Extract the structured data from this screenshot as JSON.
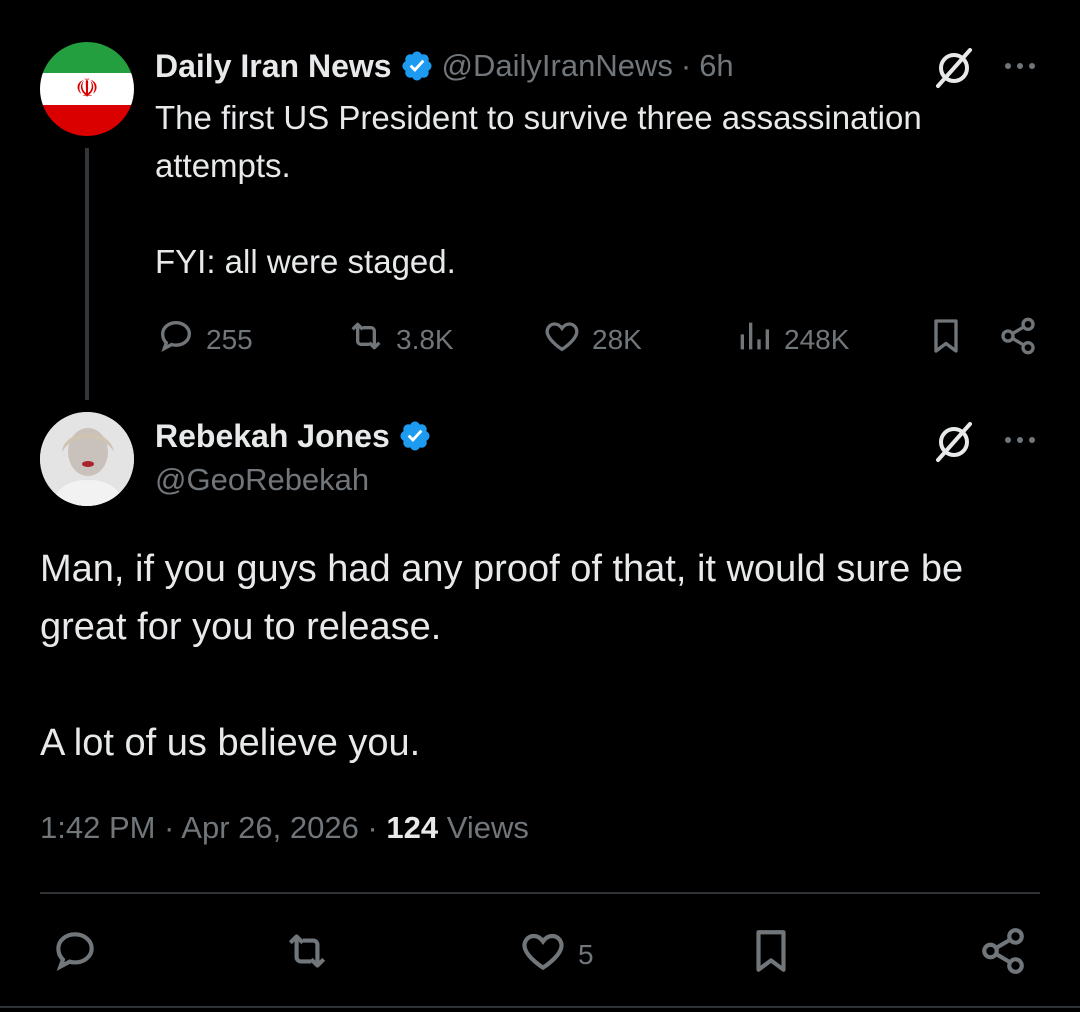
{
  "parent_tweet": {
    "display_name": "Daily Iran News",
    "handle": "@DailyIranNews",
    "separator": "·",
    "time": "6h",
    "text_line1": "The first US President to survive three assassination",
    "text_line2": "attempts.",
    "text_line3": "FYI: all were staged.",
    "replies": "255",
    "reposts": "3.8K",
    "likes": "28K",
    "views": "248K"
  },
  "main_tweet": {
    "display_name": "Rebekah Jones",
    "handle": "@GeoRebekah",
    "text_line1": "Man, if you guys had any proof of that, it would sure be",
    "text_line2": "great for you to release.",
    "text_line3": "A lot of us believe you.",
    "timestamp": "1:42 PM · Apr 26, 2026 · ",
    "views_count": "124",
    "views_label": " Views",
    "likes": "5"
  },
  "colors": {
    "background": "#000000",
    "text": "#e7e9ea",
    "muted": "#71767b",
    "verified": "#1d9bf0",
    "divider": "#2f3336"
  },
  "icons": [
    "verified-badge-icon",
    "grok-icon",
    "more-icon",
    "reply-icon",
    "repost-icon",
    "like-icon",
    "views-icon",
    "bookmark-icon",
    "share-icon"
  ]
}
